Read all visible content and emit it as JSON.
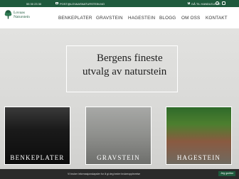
{
  "topbar": {
    "phone": "55 30 23 30",
    "email": "POST@LOVAASNATURSTEIN.NO",
    "cart": "GÅ TIL HANDLELISTE",
    "email_icon": "envelope-icon",
    "cart_icon": "cart-icon",
    "facebook_icon": "facebook-icon",
    "instagram_icon": "instagram-icon"
  },
  "logo": {
    "name_line1": "Lovaas",
    "name_line2": "Naturstein",
    "icon": "tree-icon"
  },
  "nav": {
    "items": [
      "BENKEPLATER",
      "GRAVSTEIN",
      "HAGESTEIN",
      "BLOGG",
      "OM OSS",
      "KONTAKT"
    ]
  },
  "hero": {
    "line1": "Bergens fineste",
    "line2": "utvalg av naturstein"
  },
  "cards": [
    {
      "label": "BENKEPLATER"
    },
    {
      "label": "GRAVSTEIN"
    },
    {
      "label": "HAGESTEIN"
    }
  ],
  "cookie": {
    "text": "Vi bruker informasjonskapsler for å gi deg bedre brukeropplevelse",
    "button": "Jeg godtar"
  },
  "colors": {
    "brand_green": "#1f5a3d",
    "text_dark": "#333333",
    "hero_bg": "#dcdcda"
  }
}
